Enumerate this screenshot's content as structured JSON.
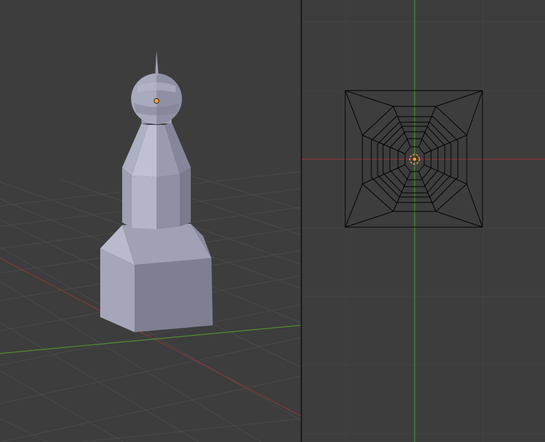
{
  "window": {
    "title": ""
  },
  "scene": {
    "object_type": "mesh",
    "shading": "solid",
    "colors": {
      "background": "#3d3d3d",
      "grid": "#4a4a4a",
      "x_axis": "#8b3636",
      "y_axis": "#4f8f32",
      "mesh_light": "#b7b8cc",
      "mesh_mid": "#9d9db0",
      "mesh_dark": "#7c7d8f",
      "origin": "#f0a346",
      "wire": "#000000",
      "divider": "#1a1a1a"
    }
  },
  "viewports": [
    {
      "mode": "perspective-solid"
    },
    {
      "mode": "top-ortho-wireframe"
    }
  ]
}
